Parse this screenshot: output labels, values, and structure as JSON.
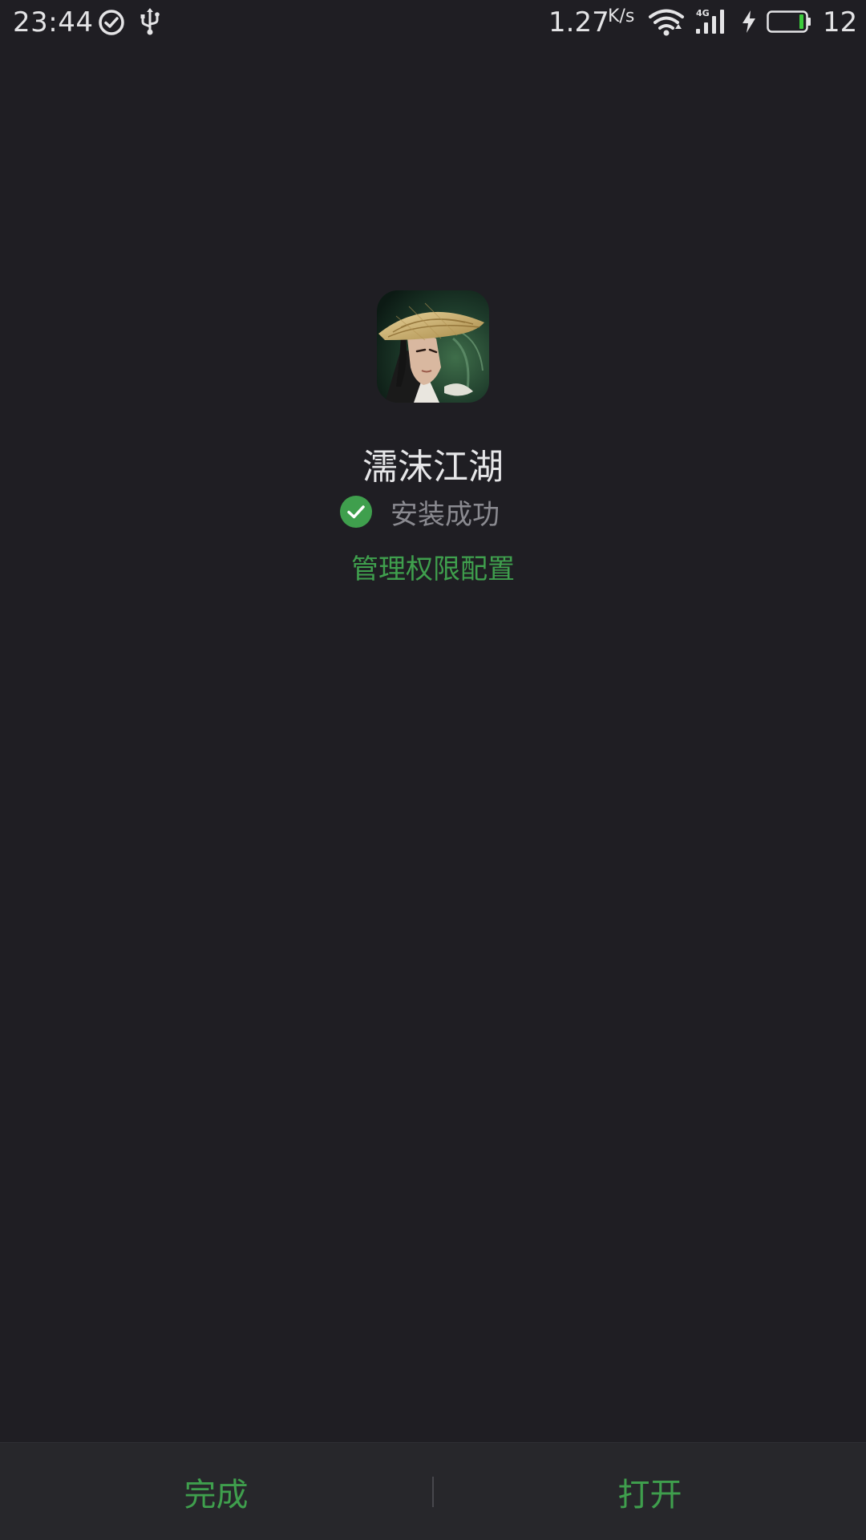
{
  "status_bar": {
    "time": "23:44",
    "net_speed": "1.27",
    "net_speed_unit": "K/s",
    "network_type": "4G",
    "battery_level": "12",
    "battery_fraction": 0.12,
    "icons": [
      "check-circle-icon",
      "usb-icon",
      "wifi-icon",
      "cellular-signal-icon",
      "charging-bolt-icon",
      "battery-icon"
    ]
  },
  "app": {
    "name": "濡沫江湖",
    "install_status": "安装成功",
    "permission_link": "管理权限配置"
  },
  "bottom_bar": {
    "done_label": "完成",
    "open_label": "打开"
  },
  "colors": {
    "background": "#1f1e23",
    "accent_green": "#3f9f4d",
    "status_gray": "#8a8a90",
    "bottom_bar": "#27272b"
  }
}
